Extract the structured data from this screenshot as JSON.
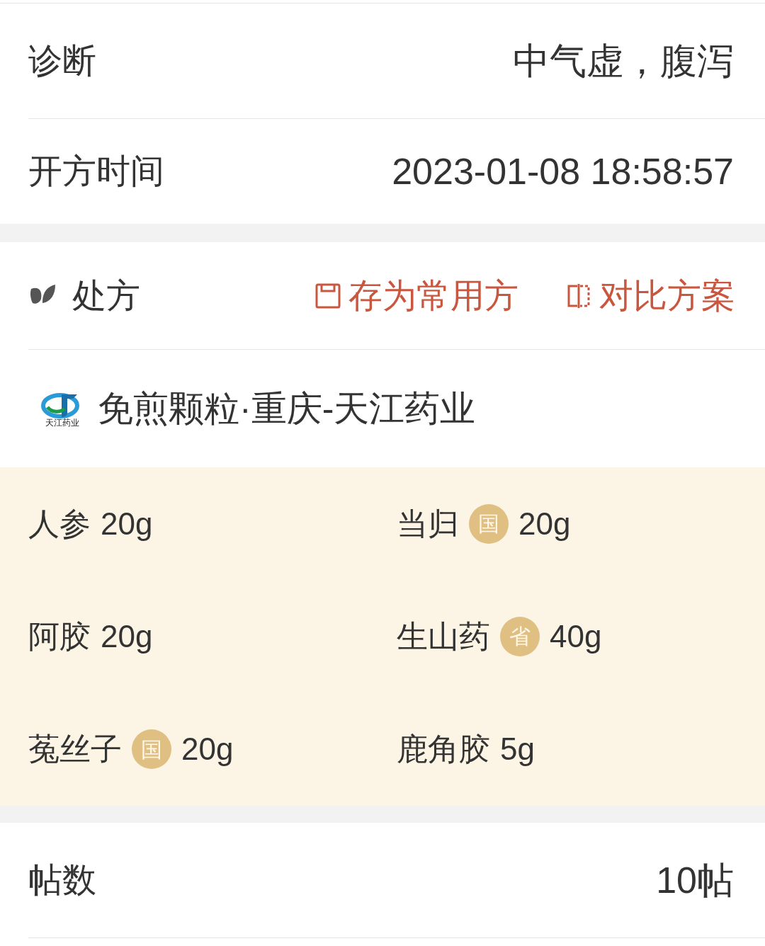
{
  "info_rows": [
    {
      "label": "诊断",
      "value": "中气虚，腹泻"
    },
    {
      "label": "开方时间",
      "value": "2023-01-08 18:58:57"
    }
  ],
  "prescription": {
    "title": "处方",
    "actions": [
      {
        "kind": "save",
        "label": "存为常用方"
      },
      {
        "kind": "compare",
        "label": "对比方案"
      }
    ],
    "pharmacy": {
      "logo_text": "天江药业",
      "name": "免煎颗粒·重庆-天江药业"
    },
    "herbs": [
      {
        "name": "人参",
        "dose": "20g"
      },
      {
        "name": "当归",
        "badge": "国",
        "dose": "20g"
      },
      {
        "name": "阿胶",
        "dose": "20g"
      },
      {
        "name": "生山药",
        "badge": "省",
        "dose": "40g"
      },
      {
        "name": "菟丝子",
        "badge": "国",
        "dose": "20g"
      },
      {
        "name": "鹿角胶",
        "dose": "5g"
      }
    ]
  },
  "dose_count": {
    "label": "帖数",
    "value": "10帖"
  }
}
